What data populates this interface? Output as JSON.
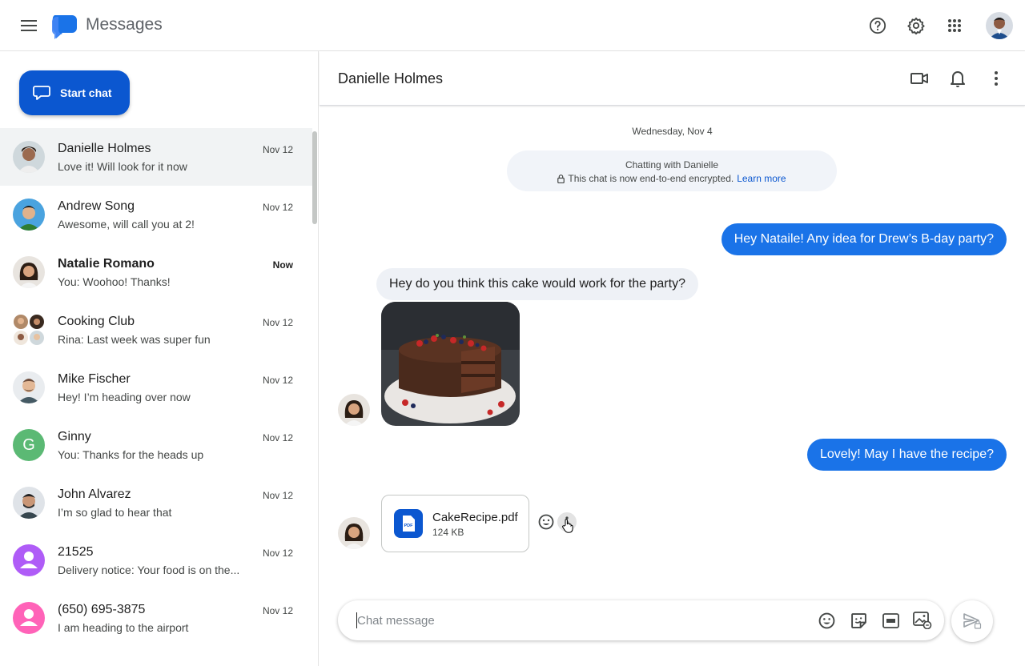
{
  "app": {
    "title": "Messages"
  },
  "header_icons": [
    "menu-icon",
    "help-icon",
    "settings-icon",
    "apps-grid-icon",
    "account-avatar"
  ],
  "sidebar": {
    "start_chat_label": "Start chat",
    "conversations": [
      {
        "name": "Danielle Holmes",
        "snippet": "Love it! Will look for it now",
        "time": "Nov 12",
        "selected": true,
        "unread": false
      },
      {
        "name": "Andrew Song",
        "snippet": "Awesome, will call you at 2!",
        "time": "Nov 12",
        "selected": false,
        "unread": false
      },
      {
        "name": "Natalie Romano",
        "snippet": "You: Woohoo! Thanks!",
        "time": "Now",
        "selected": false,
        "unread": true
      },
      {
        "name": "Cooking Club",
        "snippet": "Rina: Last week was super fun",
        "time": "Nov 12",
        "selected": false,
        "unread": false
      },
      {
        "name": "Mike Fischer",
        "snippet": "Hey! I’m heading over now",
        "time": "Nov 12",
        "selected": false,
        "unread": false
      },
      {
        "name": "Ginny",
        "snippet": "You: Thanks for the heads up",
        "time": "Nov 12",
        "selected": false,
        "unread": false
      },
      {
        "name": "John Alvarez",
        "snippet": "I’m so glad to hear that",
        "time": "Nov 12",
        "selected": false,
        "unread": false
      },
      {
        "name": "21525",
        "snippet": "Delivery notice: Your food is on the...",
        "time": "Nov 12",
        "selected": false,
        "unread": false
      },
      {
        "name": "(650) 695-3875",
        "snippet": "I am heading to the airport",
        "time": "Nov 12",
        "selected": false,
        "unread": false
      }
    ],
    "avatar_initial_ginny": "G"
  },
  "chat": {
    "contact_name": "Danielle Holmes",
    "date_separator": "Wednesday, Nov 4",
    "encryption": {
      "line1": "Chatting with Danielle",
      "line2": "This chat is now end-to-end encrypted.",
      "learn_more": "Learn more"
    },
    "messages": {
      "out1": "Hey Nataile! Any idea for Drew’s B-day party?",
      "in1": "Hey do you think this cake would work for the party?",
      "out2": "Lovely! May I have the recipe?"
    },
    "attachment": {
      "file_name": "CakeRecipe.pdf",
      "file_size": "124 KB",
      "type_label": "PDF"
    },
    "composer": {
      "placeholder": "Chat message"
    }
  },
  "colors": {
    "accent": "#0b57d0",
    "outgoing_bubble": "#1a73e8",
    "incoming_bubble": "#eef1f6",
    "selected_row": "#f1f3f4"
  }
}
